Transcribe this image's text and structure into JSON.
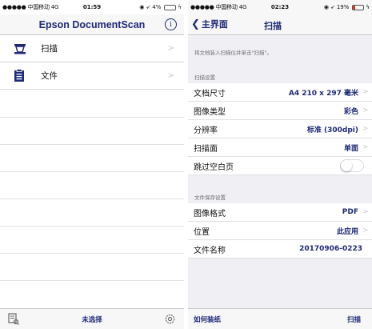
{
  "left": {
    "status": {
      "signal": "●●●●● 中国移动 4G",
      "time": "01:59",
      "battery": "4%",
      "battery_level": 0.04,
      "battery_color": "#ffffff"
    },
    "nav": {
      "title": "Epson DocumentScan",
      "info_icon": "info-icon"
    },
    "menu": [
      {
        "label": "扫描",
        "icon": "scanner-icon"
      },
      {
        "label": "文件",
        "icon": "document-icon"
      }
    ],
    "toolbar": {
      "selection_label": "未选择",
      "left_icon": "document-scan-icon",
      "right_icon": "gear-icon"
    }
  },
  "right": {
    "status": {
      "signal": "●●●●● 中国移动 4G",
      "time": "02:23",
      "battery": "19%",
      "battery_level": 0.19,
      "battery_color": "#e0342d"
    },
    "nav": {
      "back_label": "主界面",
      "title": "扫描"
    },
    "hint": "将文档装入扫描仪并单击\"扫描\"。",
    "scan_settings": {
      "header": "扫描设置",
      "rows": [
        {
          "label": "文档尺寸",
          "value": "A4 210 x 297 毫米"
        },
        {
          "label": "图像类型",
          "value": "彩色"
        },
        {
          "label": "分辨率",
          "value": "标准 (300dpi)"
        },
        {
          "label": "扫描面",
          "value": "单面"
        },
        {
          "label": "跳过空白页",
          "toggle_on": false
        }
      ]
    },
    "file_settings": {
      "header": "文件保存设置",
      "rows": [
        {
          "label": "图像格式",
          "value": "PDF"
        },
        {
          "label": "位置",
          "value": "此应用"
        },
        {
          "label": "文件名称",
          "value": "20170906-0223"
        }
      ]
    },
    "toolbar": {
      "help_label": "如何装纸",
      "scan_label": "扫描"
    }
  },
  "colors": {
    "accent": "#1e2a78",
    "background": "#efeff4",
    "separator": "#c8c7cc"
  }
}
